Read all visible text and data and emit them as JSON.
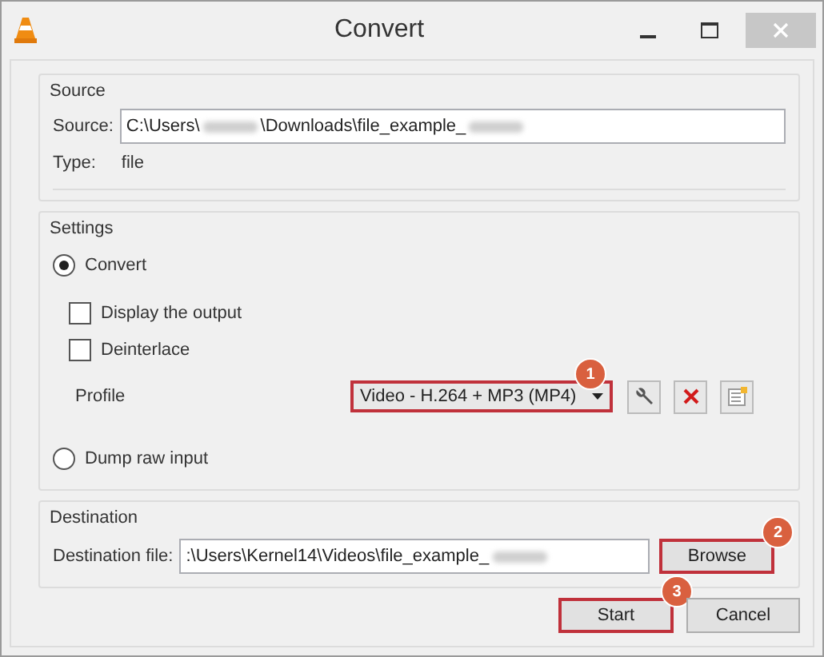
{
  "window": {
    "title": "Convert"
  },
  "source": {
    "title": "Source",
    "label": "Source:",
    "value_parts": [
      {
        "kind": "text",
        "text": "C:\\Users\\"
      },
      {
        "kind": "blurred"
      },
      {
        "kind": "text",
        "text": "\\Downloads\\file_example_"
      },
      {
        "kind": "blurred"
      }
    ],
    "type_label": "Type:",
    "type_value": "file"
  },
  "settings": {
    "title": "Settings",
    "modes": [
      {
        "label": "Convert",
        "selected": true
      },
      {
        "label": "Dump raw input",
        "selected": false
      }
    ],
    "options": [
      {
        "label": "Display the output",
        "checked": false
      },
      {
        "label": "Deinterlace",
        "checked": false
      }
    ],
    "profile": {
      "label": "Profile",
      "value": "Video - H.264 + MP3 (MP4)",
      "highlighted": true,
      "badge": "1"
    }
  },
  "destination": {
    "title": "Destination",
    "label": "Destination file:",
    "value_parts": [
      {
        "kind": "text",
        "text": ":\\Users\\Kernel14\\Videos\\file_example_"
      },
      {
        "kind": "blurred"
      }
    ],
    "browse": {
      "label": "Browse",
      "highlighted": true,
      "badge": "2"
    }
  },
  "buttons": [
    {
      "label": "Start",
      "highlighted": true,
      "badge": "3"
    },
    {
      "label": "Cancel",
      "highlighted": false
    }
  ]
}
